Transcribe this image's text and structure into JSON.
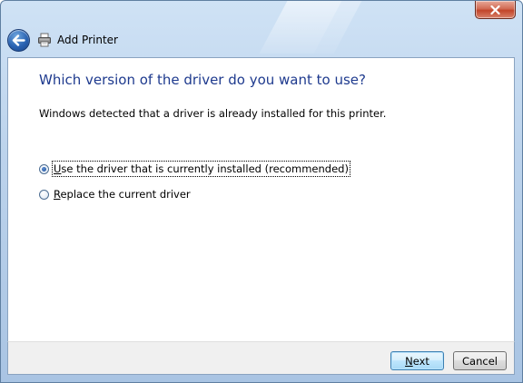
{
  "window": {
    "title": "Add Printer"
  },
  "page": {
    "heading": "Which version of the driver do you want to use?",
    "description": "Windows detected that a driver is already installed for this printer."
  },
  "options": [
    {
      "access_key": "U",
      "label_rest": "se the driver that is currently installed (recommended)",
      "selected": true
    },
    {
      "access_key": "R",
      "label_rest": "eplace the current driver",
      "selected": false
    }
  ],
  "buttons": {
    "next_key": "N",
    "next_rest": "ext",
    "cancel": "Cancel"
  },
  "icons": {
    "close": "close-icon",
    "back": "back-arrow-icon",
    "printer": "printer-icon"
  },
  "colors": {
    "heading": "#1e3a8e",
    "close_button": "#c2452a",
    "frame": "#bcd3ec"
  }
}
